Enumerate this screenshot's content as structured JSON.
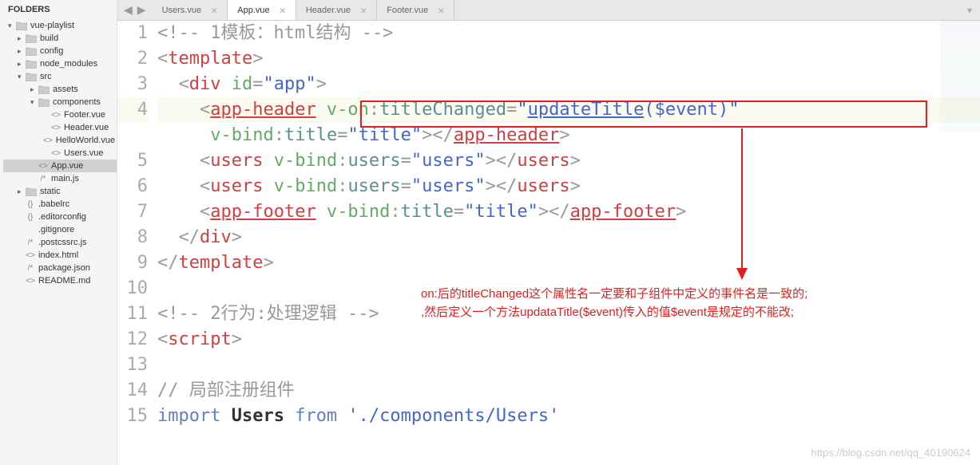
{
  "sidebar": {
    "header": "FOLDERS",
    "tree": [
      {
        "label": "vue-playlist",
        "type": "folder",
        "arrow": "▾",
        "indent": 0
      },
      {
        "label": "build",
        "type": "folder",
        "arrow": "▸",
        "indent": 1
      },
      {
        "label": "config",
        "type": "folder",
        "arrow": "▸",
        "indent": 1
      },
      {
        "label": "node_modules",
        "type": "folder",
        "arrow": "▸",
        "indent": 1
      },
      {
        "label": "src",
        "type": "folder",
        "arrow": "▾",
        "indent": 1
      },
      {
        "label": "assets",
        "type": "folder",
        "arrow": "▸",
        "indent": 2
      },
      {
        "label": "components",
        "type": "folder",
        "arrow": "▾",
        "indent": 2
      },
      {
        "label": "Footer.vue",
        "type": "file",
        "icon": "<>",
        "indent": 3
      },
      {
        "label": "Header.vue",
        "type": "file",
        "icon": "<>",
        "indent": 3
      },
      {
        "label": "HelloWorld.vue",
        "type": "file",
        "icon": "<>",
        "indent": 3
      },
      {
        "label": "Users.vue",
        "type": "file",
        "icon": "<>",
        "indent": 3
      },
      {
        "label": "App.vue",
        "type": "file",
        "icon": "<>",
        "indent": 2,
        "active": true
      },
      {
        "label": "main.js",
        "type": "file",
        "icon": "/*",
        "indent": 2
      },
      {
        "label": "static",
        "type": "folder",
        "arrow": "▸",
        "indent": 1
      },
      {
        "label": ".babelrc",
        "type": "file",
        "icon": "{}",
        "indent": 1
      },
      {
        "label": ".editorconfig",
        "type": "file",
        "icon": "{}",
        "indent": 1
      },
      {
        "label": ".gitignore",
        "type": "file",
        "icon": "",
        "indent": 1
      },
      {
        "label": ".postcssrc.js",
        "type": "file",
        "icon": "/*",
        "indent": 1
      },
      {
        "label": "index.html",
        "type": "file",
        "icon": "<>",
        "indent": 1
      },
      {
        "label": "package.json",
        "type": "file",
        "icon": "/*",
        "indent": 1
      },
      {
        "label": "README.md",
        "type": "file",
        "icon": "<>",
        "indent": 1
      }
    ]
  },
  "tabs": [
    {
      "label": "Users.vue",
      "active": false
    },
    {
      "label": "App.vue",
      "active": true
    },
    {
      "label": "Header.vue",
      "active": false
    },
    {
      "label": "Footer.vue",
      "active": false
    }
  ],
  "editor": {
    "line_numbers": [
      "1",
      "2",
      "3",
      "4",
      "",
      "5",
      "6",
      "7",
      "8",
      "9",
      "10",
      "11",
      "12",
      "13",
      "14",
      "15"
    ],
    "highlight_line": 4,
    "lines": {
      "l1_comment": "<!-- 1模板：html结构 -->",
      "l2_tag_open": "<",
      "l2_tag": "template",
      "l2_tag_close": ">",
      "l3_indent": "  ",
      "l3_tag_open": "<",
      "l3_tag": "div",
      "l3_attr": " id",
      "l3_eq": "=",
      "l3_val": "\"app\"",
      "l3_tag_close": ">",
      "l4_indent": "    ",
      "l4_tag_open": "<",
      "l4_tag": "app-header",
      "l4_attr1": " v-on",
      "l4_colon1": ":",
      "l4_attr1b": "titleChanged",
      "l4_eq1": "=",
      "l4_val1a": "\"",
      "l4_val1b": "updateTitle",
      "l4_val1c": "($event)",
      "l4_val1d": "\"",
      "l4b_indent": "     ",
      "l4b_attr": "v-bind",
      "l4b_colon": ":",
      "l4b_attr2": "title",
      "l4b_eq": "=",
      "l4b_val": "\"title\"",
      "l4b_close": "></",
      "l4b_tag": "app-header",
      "l4b_end": ">",
      "l5_indent": "    ",
      "l5_tag_open": "<",
      "l5_tag": "users",
      "l5_attr": " v-bind",
      "l5_colon": ":",
      "l5_attr2": "users",
      "l5_eq": "=",
      "l5_val": "\"users\"",
      "l5_close": "></",
      "l5_tag2": "users",
      "l5_end": ">",
      "l6_indent": "    ",
      "l6_tag_open": "<",
      "l6_tag": "users",
      "l6_attr": " v-bind",
      "l6_colon": ":",
      "l6_attr2": "users",
      "l6_eq": "=",
      "l6_val": "\"users\"",
      "l6_close": "></",
      "l6_tag2": "users",
      "l6_end": ">",
      "l7_indent": "    ",
      "l7_tag_open": "<",
      "l7_tag": "app-footer",
      "l7_attr": " v-bind",
      "l7_colon": ":",
      "l7_attr2": "title",
      "l7_eq": "=",
      "l7_val": "\"title\"",
      "l7_close": "></",
      "l7_tag2": "app-footer",
      "l7_end": ">",
      "l8_indent": "  ",
      "l8_close": "</",
      "l8_tag": "div",
      "l8_end": ">",
      "l9_close": "</",
      "l9_tag": "template",
      "l9_end": ">",
      "l11_comment": "<!-- 2行为:处理逻辑 -->",
      "l12_open": "<",
      "l12_tag": "script",
      "l12_close": ">",
      "l14_comment": "// 局部注册组件",
      "l15_import": "import ",
      "l15_ident": "Users",
      "l15_from": " from ",
      "l15_path": "'./components/Users'"
    }
  },
  "annotation": {
    "line1": "on:后的titleChanged这个属性名一定要和子组件中定义的事件名是一致的;",
    "line2": ",然后定义一个方法updataTitle($event)传入的值$event是规定的不能改;"
  },
  "watermark": "https://blog.csdn.net/qq_40190624"
}
